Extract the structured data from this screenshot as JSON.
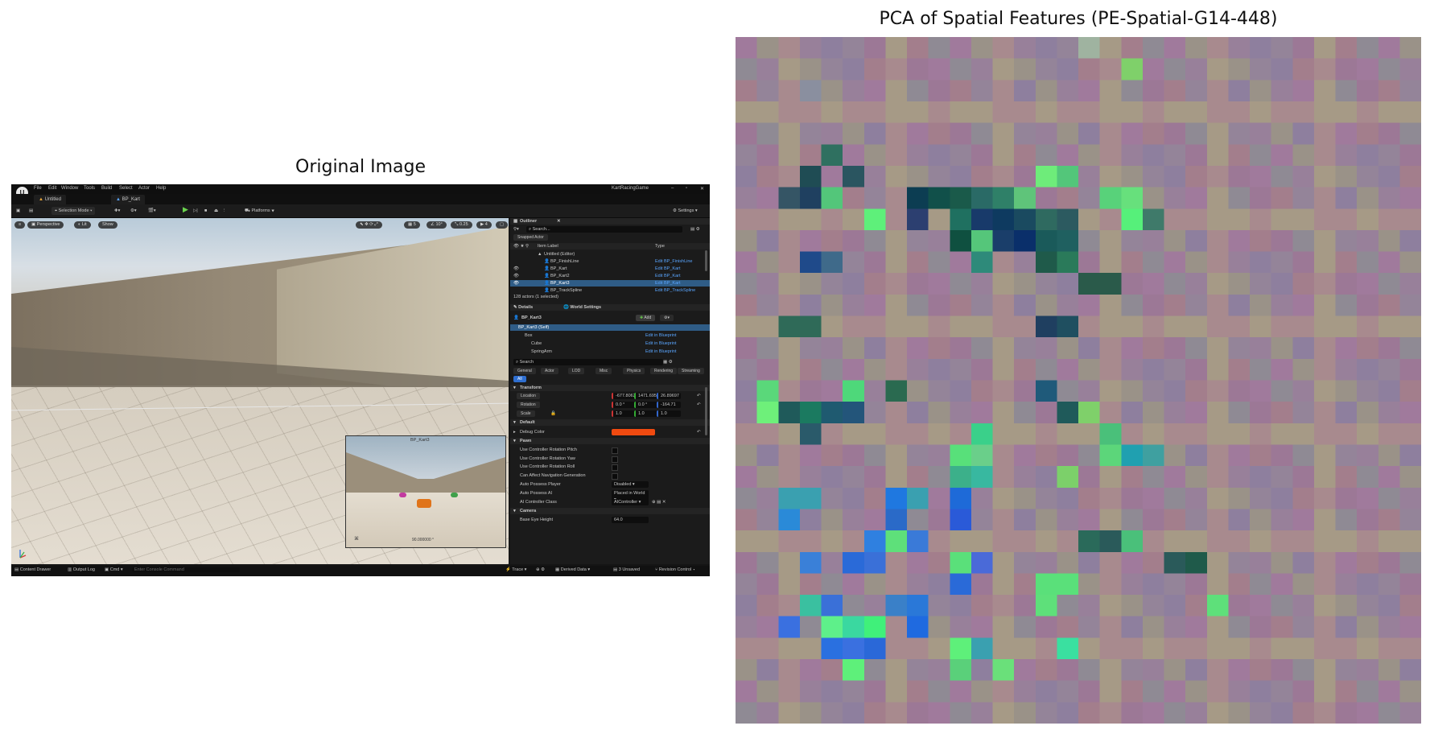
{
  "figure": {
    "left_title": "Original Image",
    "right_title": "PCA of Spatial Features (PE-Spatial-G14-448)"
  },
  "editor": {
    "menu": [
      "File",
      "Edit",
      "Window",
      "Tools",
      "Build",
      "Select",
      "Actor",
      "Help"
    ],
    "project_name": "KartRacingGame",
    "tabs": [
      "Untitled",
      "BP_Kart"
    ],
    "toolbar": {
      "selection_mode": "Selection Mode",
      "platforms": "Platforms",
      "settings": "Settings"
    },
    "viewport": {
      "perspective": "Perspective",
      "lit": "Lit",
      "show": "Show",
      "snap_values": [
        "10°",
        "0.25",
        "4"
      ],
      "inset_label": "BP_Kart3",
      "inset_value": "90.000000 °"
    },
    "outliner": {
      "title": "Outliner",
      "search_placeholder": "Search...",
      "filter": "Snapped Actor",
      "col_item": "Item Label",
      "col_type": "Type",
      "rows": [
        {
          "label": "Untitled (Editor)",
          "type": ""
        },
        {
          "label": "BP_FinishLine",
          "type": "Edit BP_FinishLine"
        },
        {
          "label": "BP_Kart",
          "type": "Edit BP_Kart"
        },
        {
          "label": "BP_Kart2",
          "type": "Edit BP_Kart"
        },
        {
          "label": "BP_Kart3",
          "type": "Edit BP_Kart"
        },
        {
          "label": "BP_TrackSpline",
          "type": "Edit BP_TrackSpline"
        }
      ],
      "count": "128 actors (1 selected)"
    },
    "details": {
      "tab_details": "Details",
      "tab_world": "World Settings",
      "actor_name": "BP_Kart3",
      "add_label": "Add",
      "components": [
        {
          "name": "BP_Kart3 (Self)",
          "action": ""
        },
        {
          "name": "Box",
          "action": "Edit in Blueprint"
        },
        {
          "name": "Cube",
          "action": "Edit in Blueprint"
        },
        {
          "name": "SpringArm",
          "action": "Edit in Blueprint"
        }
      ],
      "search_placeholder": "Search",
      "categories": [
        "General",
        "Actor",
        "LOD",
        "Misc",
        "Physics",
        "Rendering",
        "Streaming",
        "All"
      ],
      "transform_header": "Transform",
      "location_label": "Location",
      "location_values": [
        "-677.80621",
        "1471.695",
        "26.89697"
      ],
      "rotation_label": "Rotation",
      "rotation_values": [
        "0.0 °",
        "0.0 °",
        "-164.71"
      ],
      "scale_label": "Scale",
      "scale_values": [
        "1.0",
        "1.0",
        "1.0"
      ],
      "default_header": "Default",
      "debug_color_label": "Debug Color",
      "debug_color": "#f04a10",
      "pawn_header": "Pawn",
      "pawn_rows": [
        "Use Controller Rotation Pitch",
        "Use Controller Rotation Yaw",
        "Use Controller Rotation Roll",
        "Can Affect Navigation Generation"
      ],
      "auto_possess_player_label": "Auto Possess Player",
      "auto_possess_player_value": "Disabled",
      "auto_possess_ai_label": "Auto Possess AI",
      "auto_possess_ai_value": "Placed in World",
      "ai_controller_label": "AI Controller Class",
      "ai_controller_value": "AIController",
      "camera_header": "Camera",
      "base_eye_label": "Base Eye Height",
      "base_eye_value": "64.0"
    },
    "statusbar": {
      "content_drawer": "Content Drawer",
      "output_log": "Output Log",
      "cmd": "Cmd",
      "console_placeholder": "Enter Console Command",
      "trace": "Trace",
      "derived_data": "Derived Data",
      "unsaved": "3 Unsaved",
      "revision_control": "Revision Control"
    }
  },
  "pca": {
    "cols": 32,
    "rows": 32,
    "base_color": "#9a7a92",
    "patches": [
      {
        "c": 18,
        "r": 1,
        "color": "#7fd06a"
      },
      {
        "c": 16,
        "r": 0,
        "color": "#9fb3a0"
      },
      {
        "c": 3,
        "r": 2,
        "color": "#8a8f9f"
      },
      {
        "c": 4,
        "r": 5,
        "color": "#2f7060"
      },
      {
        "c": 3,
        "r": 6,
        "color": "#1f4c54"
      },
      {
        "c": 5,
        "r": 6,
        "color": "#2a5560"
      },
      {
        "c": 2,
        "r": 7,
        "color": "#355565"
      },
      {
        "c": 3,
        "r": 7,
        "color": "#1f4060"
      },
      {
        "c": 4,
        "r": 7,
        "color": "#53c67a"
      },
      {
        "c": 8,
        "r": 7,
        "color": "#0c3d52"
      },
      {
        "c": 9,
        "r": 7,
        "color": "#11504a"
      },
      {
        "c": 10,
        "r": 7,
        "color": "#1a5a4a"
      },
      {
        "c": 11,
        "r": 7,
        "color": "#2a6a66"
      },
      {
        "c": 12,
        "r": 7,
        "color": "#2f8068"
      },
      {
        "c": 13,
        "r": 7,
        "color": "#5fc47a"
      },
      {
        "c": 14,
        "r": 6,
        "color": "#6eec7a"
      },
      {
        "c": 15,
        "r": 6,
        "color": "#53c67a"
      },
      {
        "c": 17,
        "r": 7,
        "color": "#58d27a"
      },
      {
        "c": 18,
        "r": 7,
        "color": "#67e07c"
      },
      {
        "c": 6,
        "r": 8,
        "color": "#5ef07a"
      },
      {
        "c": 8,
        "r": 8,
        "color": "#2c3f70"
      },
      {
        "c": 10,
        "r": 8,
        "color": "#1f7060"
      },
      {
        "c": 11,
        "r": 8,
        "color": "#183a6a"
      },
      {
        "c": 12,
        "r": 8,
        "color": "#0e3a60"
      },
      {
        "c": 13,
        "r": 8,
        "color": "#1a4a60"
      },
      {
        "c": 14,
        "r": 8,
        "color": "#2f6a60"
      },
      {
        "c": 15,
        "r": 8,
        "color": "#2c5a60"
      },
      {
        "c": 18,
        "r": 8,
        "color": "#56f07a"
      },
      {
        "c": 19,
        "r": 8,
        "color": "#3f7a6a"
      },
      {
        "c": 10,
        "r": 9,
        "color": "#0f5040"
      },
      {
        "c": 11,
        "r": 9,
        "color": "#55c67a"
      },
      {
        "c": 12,
        "r": 9,
        "color": "#1a3e6a"
      },
      {
        "c": 13,
        "r": 9,
        "color": "#0a2f6a"
      },
      {
        "c": 14,
        "r": 9,
        "color": "#1a5a5a"
      },
      {
        "c": 15,
        "r": 9,
        "color": "#1f6060"
      },
      {
        "c": 3,
        "r": 10,
        "color": "#1f4a8a"
      },
      {
        "c": 4,
        "r": 10,
        "color": "#3f6a8a"
      },
      {
        "c": 11,
        "r": 10,
        "color": "#2e8a7a"
      },
      {
        "c": 14,
        "r": 10,
        "color": "#1f5a4a"
      },
      {
        "c": 15,
        "r": 10,
        "color": "#2a7a5a"
      },
      {
        "c": 16,
        "r": 11,
        "color": "#2a5a4a"
      },
      {
        "c": 17,
        "r": 11,
        "color": "#2a5a4a"
      },
      {
        "c": 2,
        "r": 13,
        "color": "#2f6a58"
      },
      {
        "c": 3,
        "r": 13,
        "color": "#2f6a58"
      },
      {
        "c": 14,
        "r": 13,
        "color": "#1f3f60"
      },
      {
        "c": 15,
        "r": 13,
        "color": "#1f4f60"
      },
      {
        "c": 1,
        "r": 16,
        "color": "#5ad87a"
      },
      {
        "c": 5,
        "r": 16,
        "color": "#4ed87a"
      },
      {
        "c": 7,
        "r": 16,
        "color": "#2a6a50"
      },
      {
        "c": 1,
        "r": 17,
        "color": "#6ef07a"
      },
      {
        "c": 2,
        "r": 17,
        "color": "#1f5a5a"
      },
      {
        "c": 3,
        "r": 17,
        "color": "#1b7a60"
      },
      {
        "c": 4,
        "r": 17,
        "color": "#1f5a70"
      },
      {
        "c": 5,
        "r": 17,
        "color": "#23557a"
      },
      {
        "c": 14,
        "r": 16,
        "color": "#1f5a7a"
      },
      {
        "c": 15,
        "r": 17,
        "color": "#1f5a5a"
      },
      {
        "c": 16,
        "r": 17,
        "color": "#7fd06a"
      },
      {
        "c": 3,
        "r": 18,
        "color": "#2a5a6a"
      },
      {
        "c": 11,
        "r": 18,
        "color": "#3ad08a"
      },
      {
        "c": 17,
        "r": 18,
        "color": "#4ac07a"
      },
      {
        "c": 10,
        "r": 19,
        "color": "#58e07a"
      },
      {
        "c": 11,
        "r": 19,
        "color": "#6acf8a"
      },
      {
        "c": 17,
        "r": 19,
        "color": "#5cd67a"
      },
      {
        "c": 18,
        "r": 19,
        "color": "#20a0b0"
      },
      {
        "c": 19,
        "r": 19,
        "color": "#3fa0a0"
      },
      {
        "c": 10,
        "r": 20,
        "color": "#3cb08a"
      },
      {
        "c": 11,
        "r": 20,
        "color": "#38b8a0"
      },
      {
        "c": 15,
        "r": 20,
        "color": "#7cd06a"
      },
      {
        "c": 2,
        "r": 21,
        "color": "#3aa0b0"
      },
      {
        "c": 3,
        "r": 21,
        "color": "#3aa0b0"
      },
      {
        "c": 7,
        "r": 21,
        "color": "#1f78e0"
      },
      {
        "c": 8,
        "r": 21,
        "color": "#3aa0b0"
      },
      {
        "c": 10,
        "r": 21,
        "color": "#1e6ad8"
      },
      {
        "c": 2,
        "r": 22,
        "color": "#2a8ad8"
      },
      {
        "c": 7,
        "r": 22,
        "color": "#2a6ac8"
      },
      {
        "c": 10,
        "r": 22,
        "color": "#2a5ad8"
      },
      {
        "c": 6,
        "r": 23,
        "color": "#2f80e0"
      },
      {
        "c": 7,
        "r": 23,
        "color": "#5ee07a"
      },
      {
        "c": 8,
        "r": 23,
        "color": "#3a7ad8"
      },
      {
        "c": 16,
        "r": 23,
        "color": "#2a6a5a"
      },
      {
        "c": 17,
        "r": 23,
        "color": "#2a5a5a"
      },
      {
        "c": 18,
        "r": 23,
        "color": "#4ac07a"
      },
      {
        "c": 3,
        "r": 24,
        "color": "#3a80d8"
      },
      {
        "c": 5,
        "r": 24,
        "color": "#2a6ad8"
      },
      {
        "c": 6,
        "r": 24,
        "color": "#3a70d8"
      },
      {
        "c": 10,
        "r": 24,
        "color": "#5ae07a"
      },
      {
        "c": 11,
        "r": 24,
        "color": "#4a6ad8"
      },
      {
        "c": 20,
        "r": 24,
        "color": "#2a5a5a"
      },
      {
        "c": 21,
        "r": 24,
        "color": "#1f5a4a"
      },
      {
        "c": 10,
        "r": 25,
        "color": "#2a6ad8"
      },
      {
        "c": 14,
        "r": 25,
        "color": "#5ae07a"
      },
      {
        "c": 15,
        "r": 25,
        "color": "#5ae07a"
      },
      {
        "c": 3,
        "r": 26,
        "color": "#3ac0a0"
      },
      {
        "c": 4,
        "r": 26,
        "color": "#3a70d8"
      },
      {
        "c": 7,
        "r": 26,
        "color": "#3a80c8"
      },
      {
        "c": 8,
        "r": 26,
        "color": "#2a78d8"
      },
      {
        "c": 14,
        "r": 26,
        "color": "#5ee07a"
      },
      {
        "c": 22,
        "r": 26,
        "color": "#5ee07a"
      },
      {
        "c": 2,
        "r": 27,
        "color": "#3a70e0"
      },
      {
        "c": 4,
        "r": 27,
        "color": "#5ef08a"
      },
      {
        "c": 5,
        "r": 27,
        "color": "#3ad8a0"
      },
      {
        "c": 6,
        "r": 27,
        "color": "#40f07a"
      },
      {
        "c": 8,
        "r": 27,
        "color": "#1f6ae0"
      },
      {
        "c": 4,
        "r": 28,
        "color": "#2a70e0"
      },
      {
        "c": 5,
        "r": 28,
        "color": "#3a70e0"
      },
      {
        "c": 6,
        "r": 28,
        "color": "#2a68d8"
      },
      {
        "c": 10,
        "r": 28,
        "color": "#5ef07a"
      },
      {
        "c": 11,
        "r": 28,
        "color": "#3aa0b0"
      },
      {
        "c": 15,
        "r": 28,
        "color": "#3ae0a0"
      },
      {
        "c": 5,
        "r": 29,
        "color": "#5ef07a"
      },
      {
        "c": 10,
        "r": 29,
        "color": "#5ad07a"
      },
      {
        "c": 12,
        "r": 29,
        "color": "#6ae07a"
      }
    ]
  }
}
